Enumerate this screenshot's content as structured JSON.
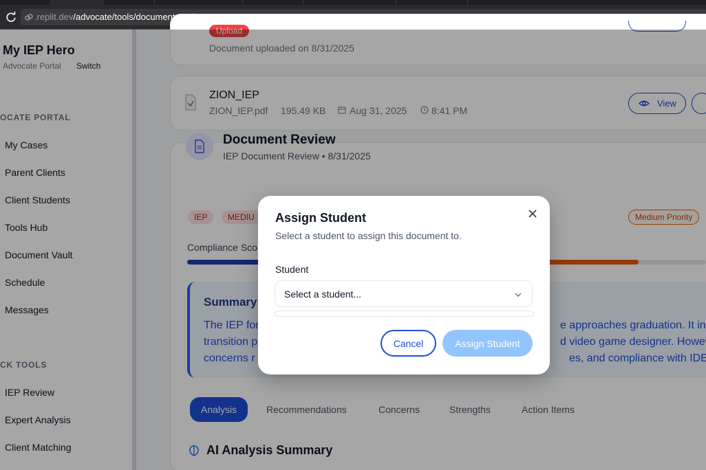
{
  "browser": {
    "url_host": ".replit.dev",
    "url_path": "/advocate/tools/document-vault"
  },
  "sidebar": {
    "brand": "My IEP Hero",
    "subtitle": "Advocate Portal",
    "switch_label": "Switch",
    "section_portal": "OCATE PORTAL",
    "portal_items": [
      "My Cases",
      "Parent Clients",
      "Client Students",
      "Tools Hub",
      "Document Vault",
      "Schedule",
      "Messages"
    ],
    "section_tools": "CK TOOLS",
    "tool_items": [
      "IEP Review",
      "Expert Analysis",
      "Client Matching"
    ]
  },
  "main": {
    "upload_badge": "Upload",
    "uploaded_text": "Document uploaded on 8/31/2025",
    "document": {
      "title": "ZION_IEP",
      "filename": "ZION_IEP.pdf",
      "size": "195.49 KB",
      "date": "Aug 31, 2025",
      "time": "8:41 PM",
      "view_label": "View"
    },
    "review": {
      "title": "Document Review",
      "subtitle": "IEP Document Review • 8/31/2025",
      "tag_iep": "IEP",
      "tag_medium": "MEDIU",
      "priority": "Medium Priority",
      "compliance_label": "Compliance Sco",
      "compliance_fraction": 0.87
    },
    "summary": {
      "title": "Summary",
      "line1_left": "The IEP for",
      "line1_right": "e approaches graduation. It inc",
      "line2_left": "transition p",
      "line2_right": "d video game designer. Howev",
      "line3_left": "concerns r",
      "line3_right": "es, and compliance with IDEA r"
    },
    "tabs": [
      "Analysis",
      "Recommendations",
      "Concerns",
      "Strengths",
      "Action Items"
    ],
    "ai_title": "AI Analysis Summary"
  },
  "modal": {
    "title": "Assign Student",
    "description": "Select a student to assign this document to.",
    "field_label": "Student",
    "select_value": "Select a student...",
    "cancel_label": "Cancel",
    "assign_label": "Assign Student"
  }
}
